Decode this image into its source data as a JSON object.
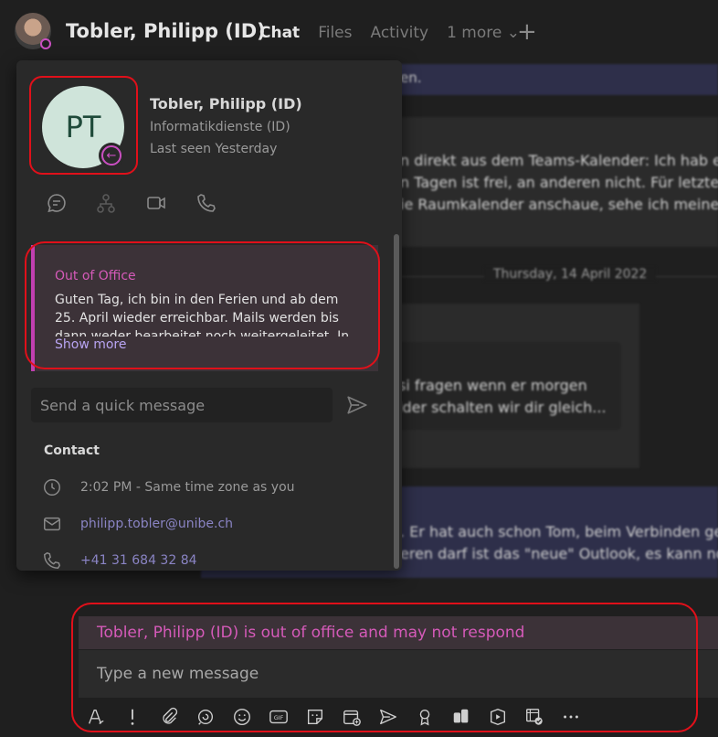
{
  "header": {
    "name": "Tobler, Philipp (ID)",
    "tabs": [
      {
        "label": "Chat",
        "active": true
      },
      {
        "label": "Files",
        "active": false
      },
      {
        "label": "Activity",
        "active": false
      },
      {
        "label": "1 more ⌄",
        "active": false
      }
    ],
    "add_tab_icon": "plus-icon"
  },
  "background_chat": {
    "strip_text": "en.",
    "msg1_lines": [
      "n direkt aus dem Teams-Kalender: Ich hab ein",
      "n Tagen ist frei, an anderen nicht. Für letztere",
      "ie Raumkalender anschaue, sehe ich meine R"
    ],
    "date_separator": "Thursday, 14 April 2022",
    "msg2_lines": [
      "si fragen wenn er morgen",
      "lder schalten wir dir gleich..."
    ],
    "msg3_lines": [
      ". Er hat auch schon Tom, beim Verbinden geh",
      "eren darf ist das \"neue\" Outlook, es kann noc"
    ]
  },
  "profile_card": {
    "initials": "PT",
    "name": "Tobler, Philipp (ID)",
    "department": "Informatikdienste (ID)",
    "last_seen": "Last seen Yesterday",
    "status_color": "#c94fc1",
    "actions": [
      "chat-icon",
      "org-chart-icon",
      "video-call-icon",
      "phone-icon"
    ],
    "out_of_office": {
      "title": "Out of Office",
      "text": "Guten Tag, ich bin in den Ferien und ab dem 25. April wieder erreichbar. Mails werden bis dann weder bearbeitet noch weitergeleitet. In",
      "show_more": "Show more"
    },
    "quick_message_placeholder": "Send a quick message",
    "contact": {
      "title": "Contact",
      "time": "2:02 PM - Same time zone as you",
      "email": "philipp.tobler@unibe.ch",
      "phone": "+41 31 684 32 84"
    }
  },
  "compose": {
    "banner": "Tobler, Philipp (ID) is out of office and may not respond",
    "placeholder": "Type a new message",
    "toolbar_icons": [
      "format-icon",
      "priority-icon",
      "attach-icon",
      "loop-icon",
      "emoji-icon",
      "gif-icon",
      "sticker-icon",
      "schedule-meeting-icon",
      "send-later-icon",
      "praise-icon",
      "app-icon",
      "stream-icon",
      "approvals-icon",
      "more-icon"
    ]
  },
  "colors": {
    "accent_pink": "#d55ab9",
    "link_purple": "#b8a4f2",
    "highlight_red": "#e0101a"
  }
}
